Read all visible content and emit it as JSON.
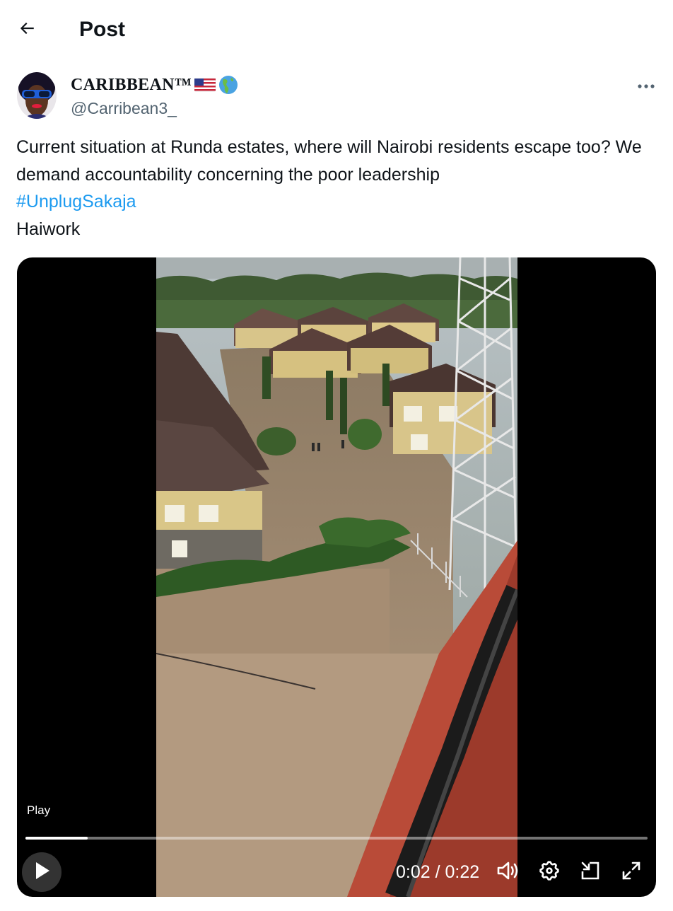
{
  "header": {
    "title": "Post",
    "back_icon": "arrow-left-icon"
  },
  "author": {
    "display_name": "CARIBBEAN™",
    "name_emojis": [
      "us-flag-icon",
      "globe-americas-icon"
    ],
    "handle": "@Carribean3_",
    "more_icon": "more-horizontal-icon"
  },
  "tweet": {
    "text_part1": "Current situation at Runda estates, where will Nairobi residents escape too? We demand accountability concerning the poor leadership",
    "hashtag": "#UnplugSakaja",
    "text_part2": "Haiwork"
  },
  "video": {
    "play_label": "Play",
    "current_time": "0:02",
    "duration": "0:22",
    "time_display": "0:02 / 0:22",
    "progress_fraction": 0.1,
    "controls": [
      "play-icon",
      "volume-icon",
      "settings-icon",
      "picture-in-picture-icon",
      "fullscreen-icon"
    ]
  },
  "colors": {
    "accent": "#1d9bf0",
    "text": "#0f1419",
    "secondary_text": "#536471",
    "video_background": "#000000"
  }
}
